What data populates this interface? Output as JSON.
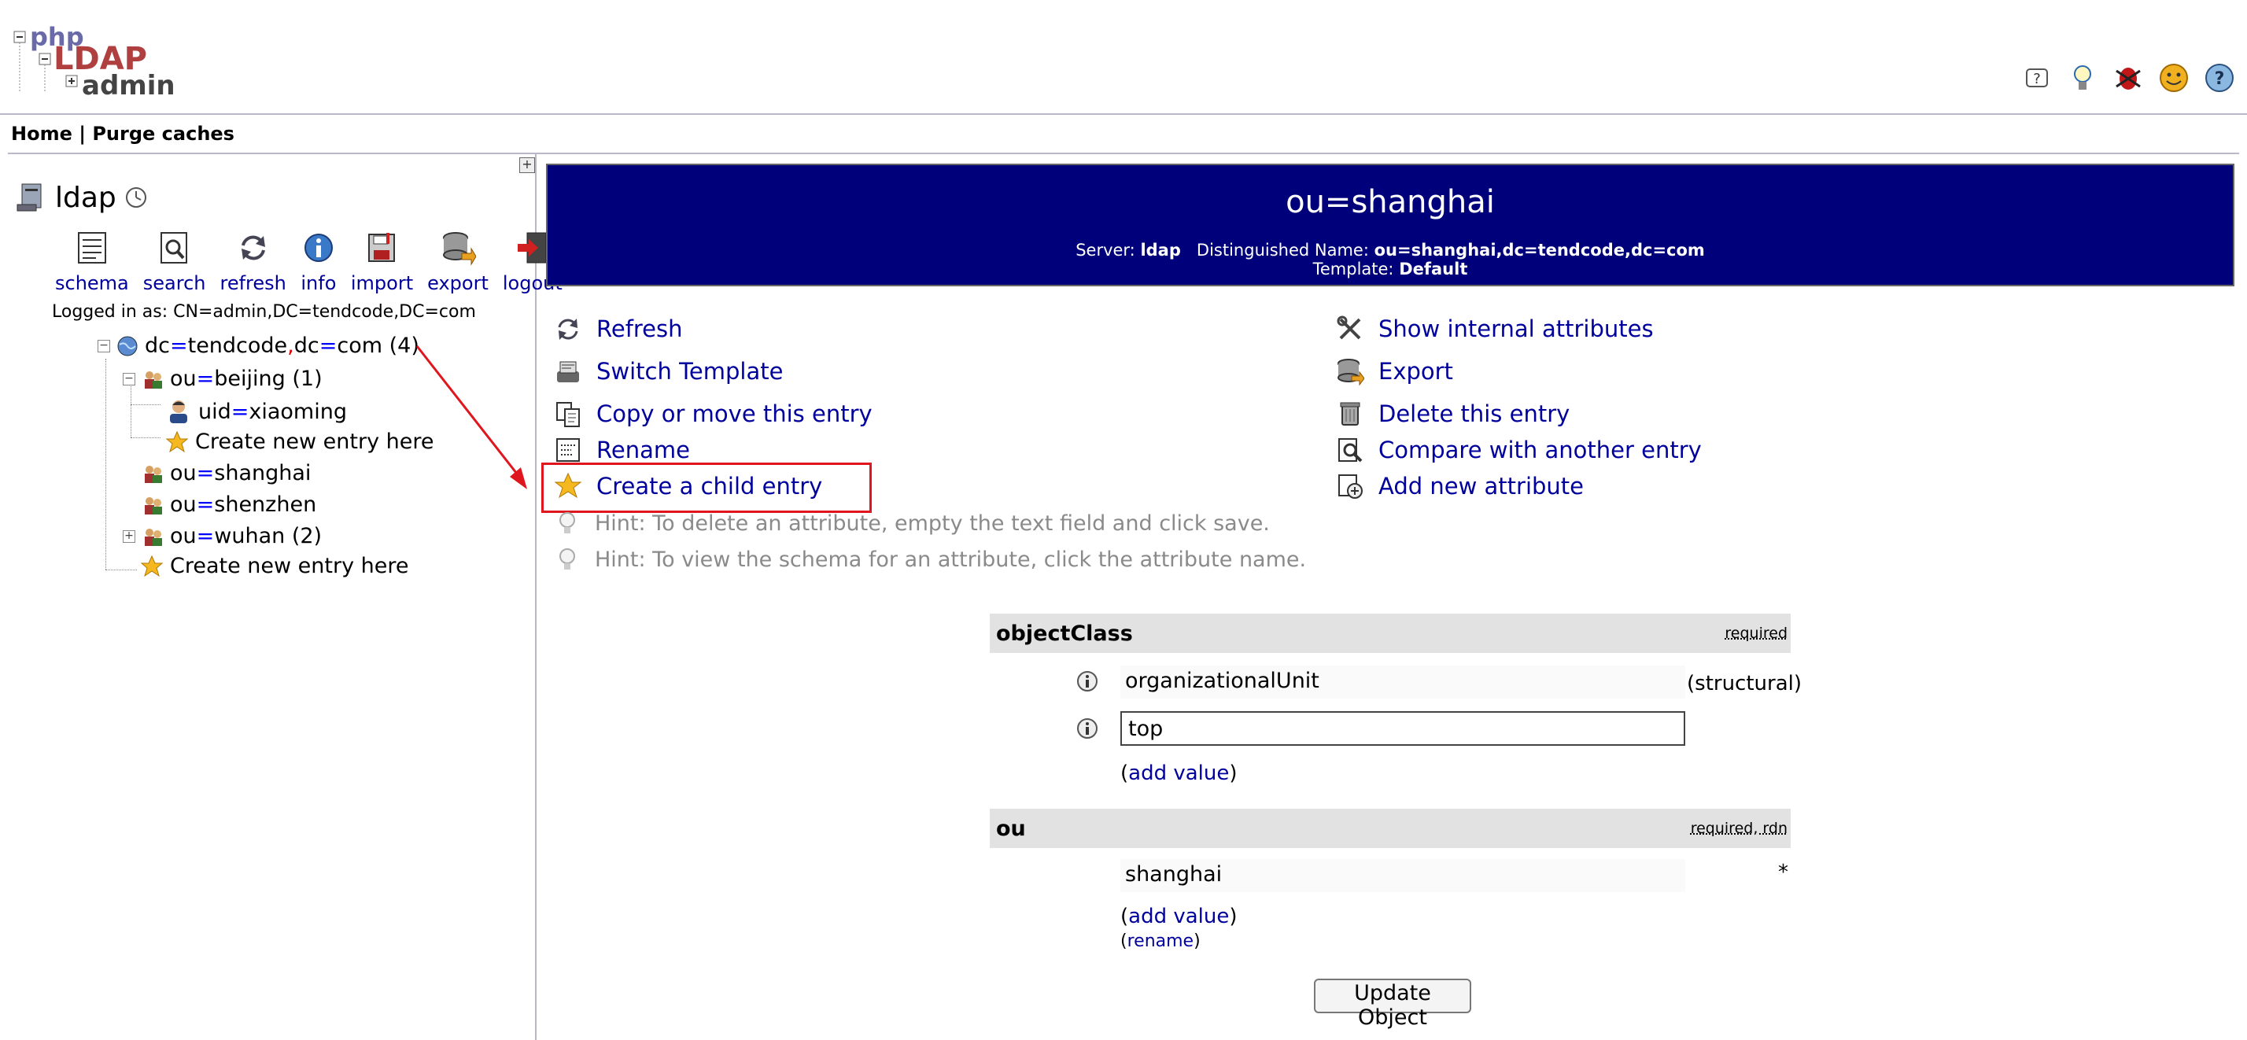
{
  "menu": {
    "home": "Home",
    "sep": "|",
    "purge": "Purge caches"
  },
  "logo_text": {
    "php": "php",
    "ldap": "LDAP",
    "admin": "admin"
  },
  "server": {
    "name": "ldap"
  },
  "tools": [
    {
      "label": "schema",
      "icon": "schema-icon"
    },
    {
      "label": "search",
      "icon": "search-icon"
    },
    {
      "label": "refresh",
      "icon": "refresh-icon"
    },
    {
      "label": "info",
      "icon": "info-icon"
    },
    {
      "label": "import",
      "icon": "import-icon"
    },
    {
      "label": "export",
      "icon": "export-icon"
    },
    {
      "label": "logout",
      "icon": "logout-icon"
    }
  ],
  "logged_in": "Logged in as: CN=admin,DC=tendcode,DC=com",
  "tree": {
    "root": {
      "a": "dc",
      "b": "tendcode",
      "c": "dc",
      "d": "com",
      "count": "(4)"
    },
    "beijing": {
      "k": "ou",
      "v": "beijing",
      "count": "(1)"
    },
    "xiaoming": {
      "k": "uid",
      "v": "xiaoming"
    },
    "create_here_1": "Create new entry here",
    "shanghai": {
      "k": "ou",
      "v": "shanghai"
    },
    "shenzhen": {
      "k": "ou",
      "v": "shenzhen"
    },
    "wuhan": {
      "k": "ou",
      "v": "wuhan",
      "count": "(2)"
    },
    "create_here_2": "Create new entry here"
  },
  "entry": {
    "title": "ou=shanghai",
    "server_label": "Server:",
    "server_value": "ldap",
    "dn_label": "Distinguished Name:",
    "dn_value": "ou=shanghai,dc=tendcode,dc=com",
    "template_label": "Template:",
    "template_value": "Default"
  },
  "actions": {
    "refresh": "Refresh",
    "switch_template": "Switch Template",
    "copy_move": "Copy or move this entry",
    "rename": "Rename",
    "create_child": "Create a child entry",
    "show_internal": "Show internal attributes",
    "export": "Export",
    "delete": "Delete this entry",
    "compare": "Compare with another entry",
    "add_attribute": "Add new attribute"
  },
  "hints": [
    "Hint: To delete an attribute, empty the text field and click save.",
    "Hint: To view the schema for an attribute, click the attribute name."
  ],
  "attributes": {
    "objectclass": {
      "name": "objectClass",
      "tag": "required",
      "value1": "organizationalUnit",
      "value1_note": "(structural)",
      "value2": "top",
      "add_value_open": "(",
      "add_value": "add value",
      "add_value_close": ")"
    },
    "ou": {
      "name": "ou",
      "tag": "required, rdn",
      "value": "shanghai",
      "star": "*",
      "add_value_open": "(",
      "add_value": "add value",
      "add_value_close": ")",
      "rename_open": "(",
      "rename": "rename",
      "rename_close": ")"
    }
  },
  "update_button": "Update Object",
  "colors": {
    "banner": "#00007a",
    "link": "#00009c",
    "highlight": "#e0161e"
  }
}
